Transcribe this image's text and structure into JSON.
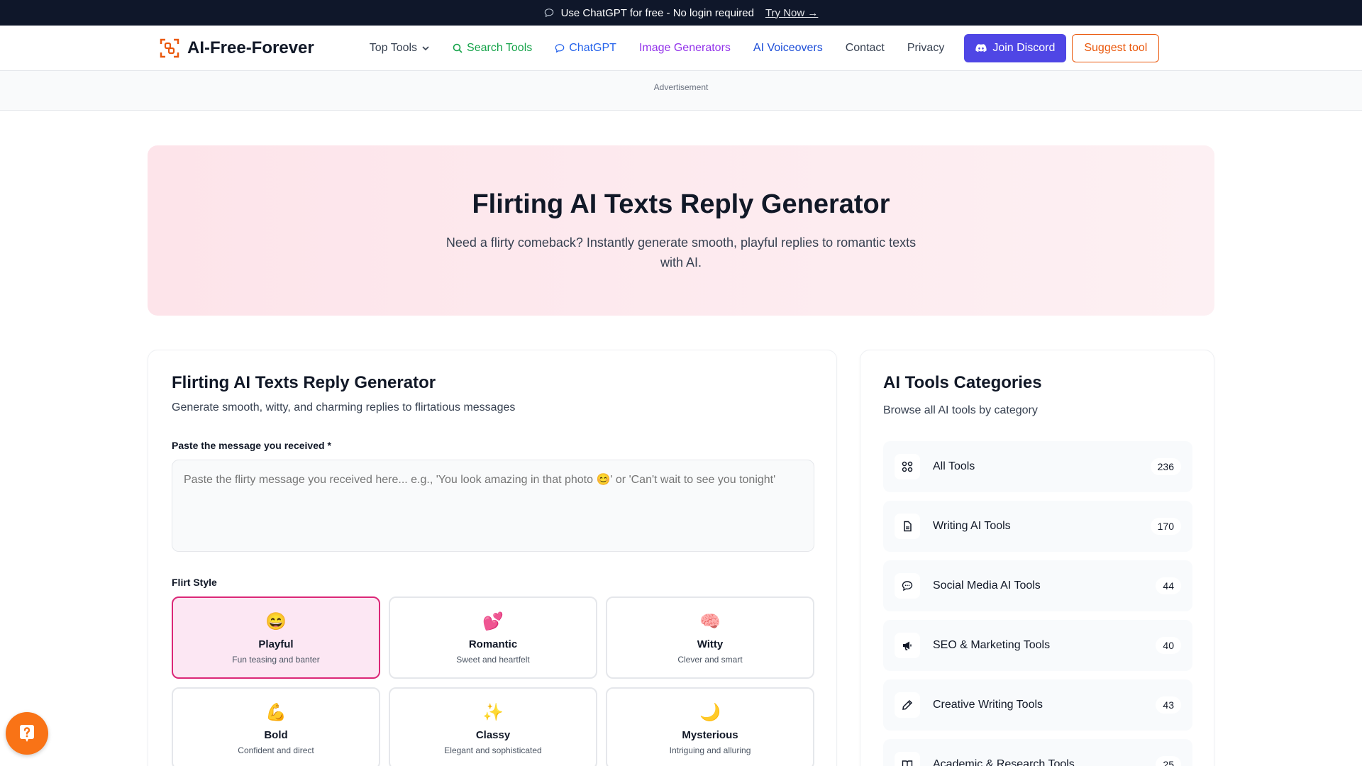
{
  "banner": {
    "text": "Use ChatGPT for free - No login required",
    "link": "Try Now →"
  },
  "header": {
    "logo": "AI-Free-Forever",
    "nav": {
      "top_tools": "Top Tools",
      "search_tools": "Search Tools",
      "chatgpt": "ChatGPT",
      "image_generators": "Image Generators",
      "ai_voiceovers": "AI Voiceovers",
      "contact": "Contact",
      "privacy": "Privacy"
    },
    "join_discord": "Join Discord",
    "suggest_tool": "Suggest tool"
  },
  "ad": {
    "label": "Advertisement"
  },
  "hero": {
    "title": "Flirting AI Texts Reply Generator",
    "subtitle": "Need a flirty comeback? Instantly generate smooth, playful replies to romantic texts with AI."
  },
  "generator": {
    "title": "Flirting AI Texts Reply Generator",
    "subtitle": "Generate smooth, witty, and charming replies to flirtatious messages",
    "message_label": "Paste the message you received *",
    "message_placeholder": "Paste the flirty message you received here... e.g., 'You look amazing in that photo 😊' or 'Can't wait to see you tonight'",
    "message_value": "",
    "style_label": "Flirt Style",
    "styles": [
      {
        "emoji": "😄",
        "name": "Playful",
        "desc": "Fun teasing and banter",
        "selected": true
      },
      {
        "emoji": "💕",
        "name": "Romantic",
        "desc": "Sweet and heartfelt"
      },
      {
        "emoji": "🧠",
        "name": "Witty",
        "desc": "Clever and smart"
      },
      {
        "emoji": "💪",
        "name": "Bold",
        "desc": "Confident and direct"
      },
      {
        "emoji": "✨",
        "name": "Classy",
        "desc": "Elegant and sophisticated"
      },
      {
        "emoji": "🌙",
        "name": "Mysterious",
        "desc": "Intriguing and alluring"
      }
    ]
  },
  "categories": {
    "title": "AI Tools Categories",
    "subtitle": "Browse all AI tools by category",
    "items": [
      {
        "icon": "grid-icon",
        "name": "All Tools",
        "count": "236"
      },
      {
        "icon": "document-icon",
        "name": "Writing AI Tools",
        "count": "170"
      },
      {
        "icon": "chat-bubble-icon",
        "name": "Social Media AI Tools",
        "count": "44"
      },
      {
        "icon": "megaphone-icon",
        "name": "SEO & Marketing Tools",
        "count": "40"
      },
      {
        "icon": "pencil-icon",
        "name": "Creative Writing Tools",
        "count": "43"
      },
      {
        "icon": "book-icon",
        "name": "Academic & Research Tools",
        "count": "25"
      }
    ]
  },
  "colors": {
    "accent_pink": "#db2777",
    "discord": "#4f46e5",
    "suggest": "#ea580c",
    "help": "#f97316"
  }
}
